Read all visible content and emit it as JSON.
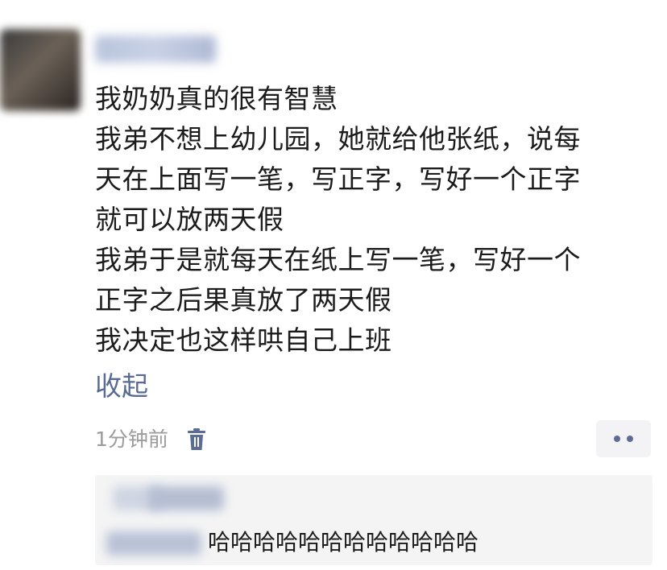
{
  "post": {
    "lines": [
      "我奶奶真的很有智慧",
      "我弟不想上幼儿园，她就给他张纸，说每",
      "天在上面写一笔，写正字，写好一个正字",
      "就可以放两天假",
      "我弟于是就每天在纸上写一笔，写好一个",
      "正字之后果真放了两天假",
      "我决定也这样哄自己上班"
    ],
    "collapse_label": "收起"
  },
  "meta": {
    "timestamp": "1分钟前",
    "delete_icon": "trash-icon",
    "more_icon": "more-dots-icon"
  },
  "comments": [
    {
      "text": ""
    },
    {
      "text": "哈哈哈哈哈哈哈哈哈哈哈哈"
    }
  ],
  "colors": {
    "link": "#576b95",
    "text": "#1b1b1b",
    "muted": "#9b9b9b",
    "comment_bg": "#f4f4f5"
  }
}
